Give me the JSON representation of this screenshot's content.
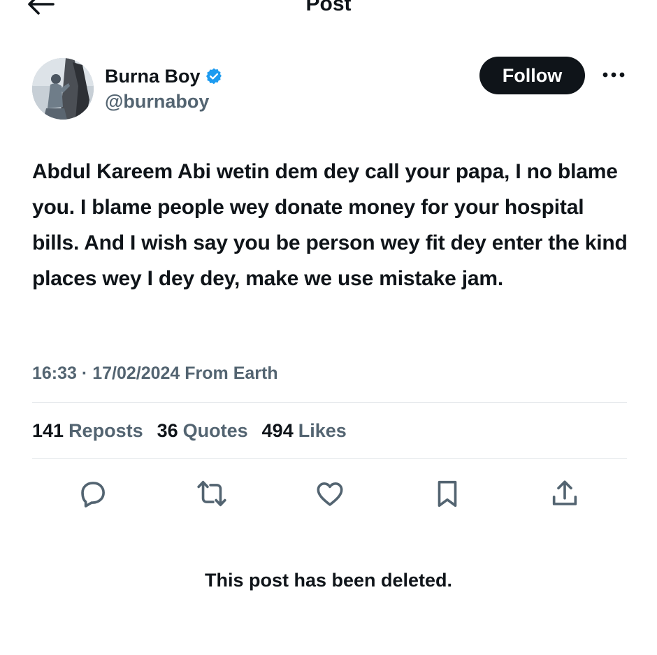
{
  "header": {
    "title": "Post",
    "back_icon": "arrow-left-icon"
  },
  "author": {
    "name": "Burna Boy",
    "handle": "@burnaboy",
    "verified": true,
    "verified_color": "#1d9bf0",
    "follow_label": "Follow",
    "more_icon": "ellipsis-icon"
  },
  "post": {
    "text": "Abdul Kareem Abi wetin dem dey call your papa, I no blame you. I blame people wey donate money for your hospital bills. And I wish say you be person wey fit dey enter the kind places wey I dey dey, make we use mistake jam.",
    "time": "16:33",
    "separator": "·",
    "date": "17/02/2024",
    "source": "From Earth"
  },
  "stats": {
    "reposts_count": "141",
    "reposts_label": "Reposts",
    "quotes_count": "36",
    "quotes_label": "Quotes",
    "likes_count": "494",
    "likes_label": "Likes"
  },
  "actions": [
    {
      "icon": "reply-icon"
    },
    {
      "icon": "repost-icon"
    },
    {
      "icon": "like-icon"
    },
    {
      "icon": "bookmark-icon"
    },
    {
      "icon": "share-icon"
    }
  ],
  "notice": {
    "deleted_text": "This post has been deleted."
  },
  "colors": {
    "text_primary": "#0f1419",
    "text_secondary": "#536471",
    "button_bg": "#0f1419",
    "divider": "#e2e6e9"
  }
}
